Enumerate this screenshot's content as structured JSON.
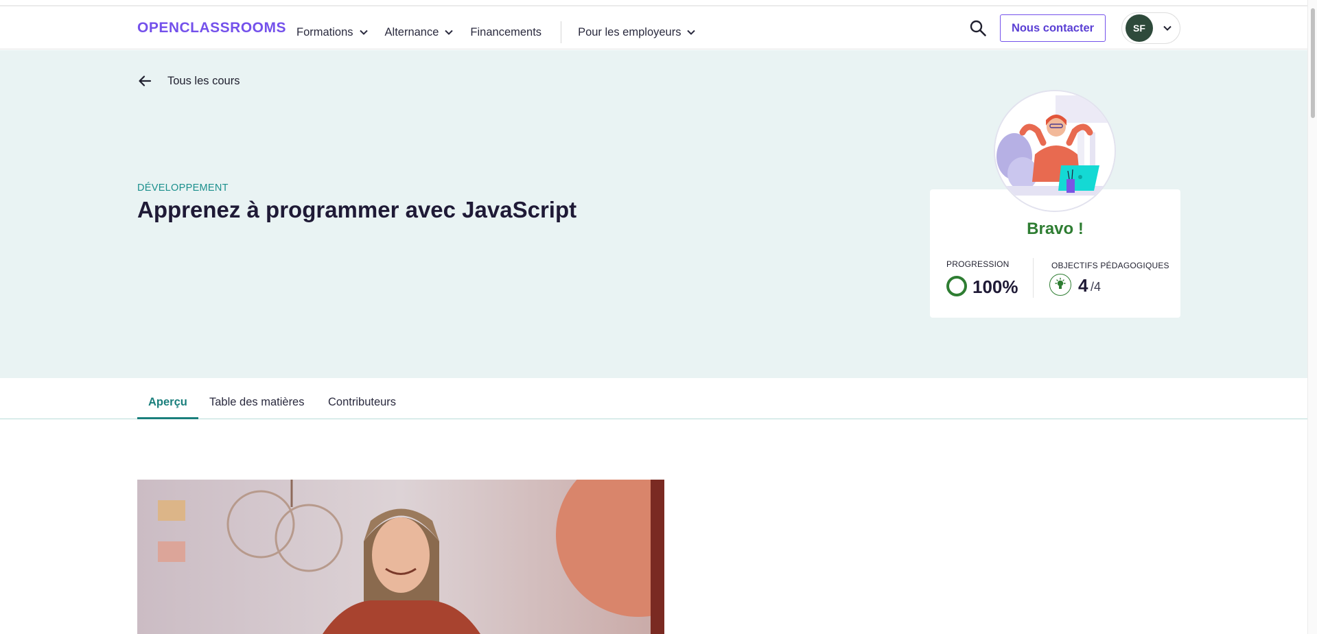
{
  "header": {
    "logo": "OPENCLASSROOMS",
    "nav": [
      {
        "label": "Formations",
        "has_menu": true
      },
      {
        "label": "Alternance",
        "has_menu": true
      },
      {
        "label": "Financements",
        "has_menu": false
      },
      {
        "label": "Pour les employeurs",
        "has_menu": true
      }
    ],
    "search_icon": "search-icon",
    "contact_label": "Nous contacter",
    "user_initials": "SF"
  },
  "hero": {
    "back_label": "Tous les cours",
    "category": "DÉVELOPPEMENT",
    "title": "Apprenez à programmer avec JavaScript",
    "card": {
      "headline": "Bravo !",
      "progress_label": "PROGRESSION",
      "progress_value": "100%",
      "progress_fraction": 1.0,
      "objectives_label": "OBJECTIFS PÉDAGOGIQUES",
      "objectives_done": "4",
      "objectives_total": "/4"
    }
  },
  "tabs": [
    {
      "label": "Aperçu",
      "active": true
    },
    {
      "label": "Table des matières",
      "active": false
    },
    {
      "label": "Contributeurs",
      "active": false
    }
  ],
  "colors": {
    "brand": "#7451eb",
    "accent": "#1a7f7c",
    "success": "#2e7d32",
    "hero_bg": "#e9f3f3"
  }
}
